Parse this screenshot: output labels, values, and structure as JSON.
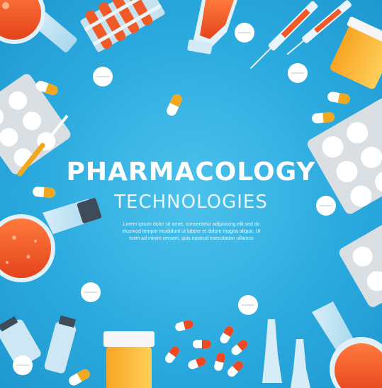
{
  "title": "PHARMACOLOGY",
  "subtitle": "TECHNOLOGIES",
  "body": "Lorem ipsum dolor sit amet, consectetur adipisicing elit,sed do eiusmod tempor incididunt ut labore et dolore magna aliqua. Ut enim ad minim veniam, quis nostrud exercitation ullamco",
  "colors": {
    "background": "#2aa9de",
    "liquid": "#f05a28",
    "capsule_accent": "#f2a81d",
    "white": "#ffffff"
  }
}
